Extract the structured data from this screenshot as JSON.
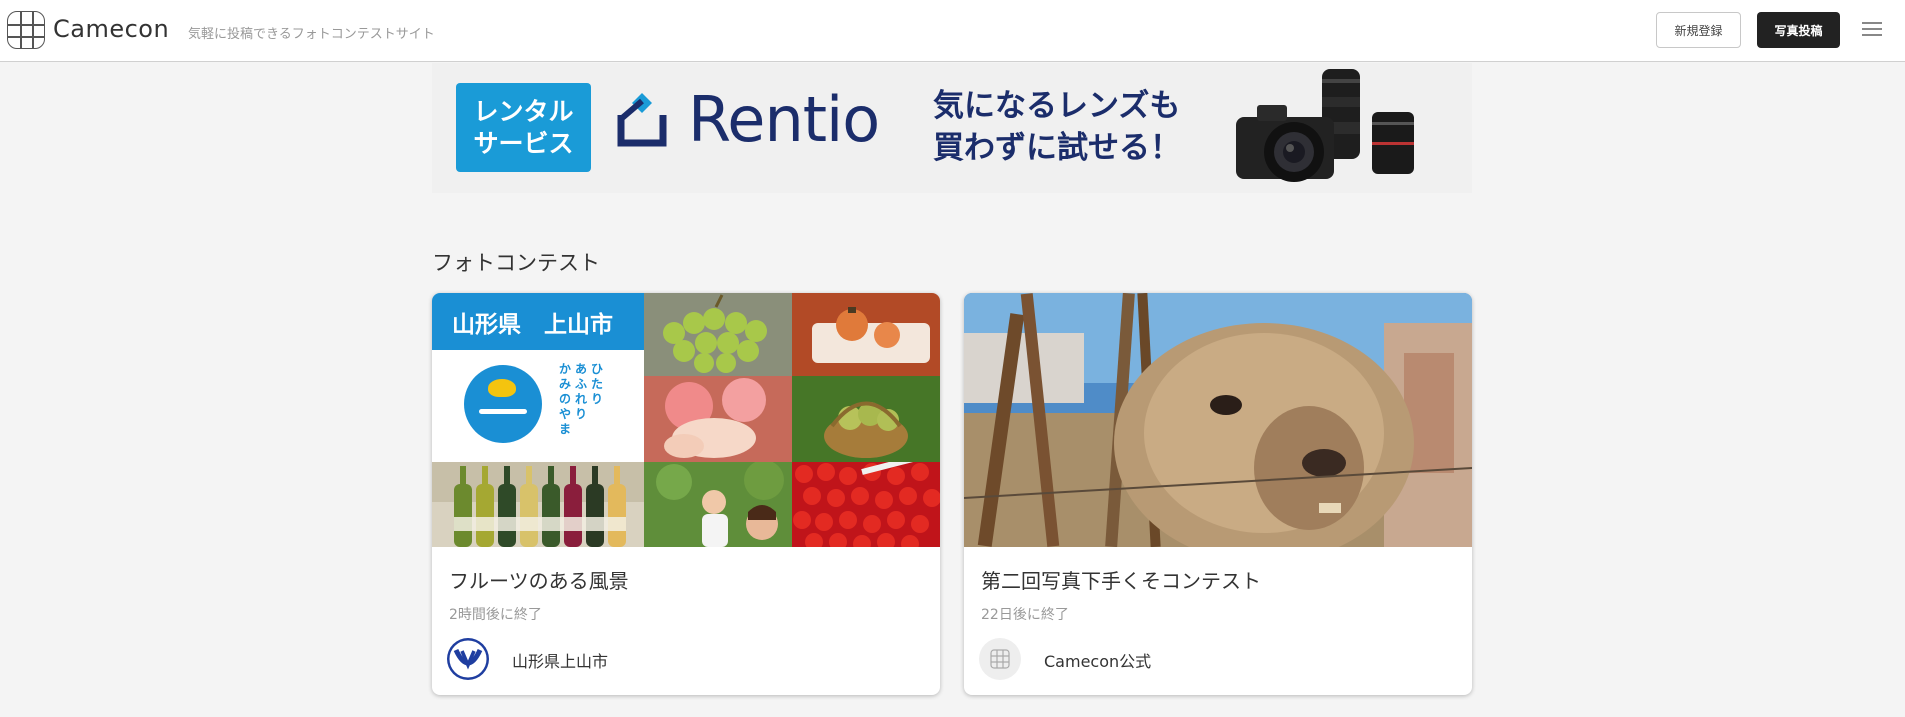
{
  "header": {
    "brand": "Camecon",
    "tagline": "気軽に投稿できるフォトコンテストサイト",
    "register_label": "新規登録",
    "post_label": "写真投稿"
  },
  "banner": {
    "box_line1": "レンタル",
    "box_line2": "サービス",
    "brand": "Rentio",
    "copy_line1": "気になるレンズも",
    "copy_line2": "買わずに試せる！",
    "colors": {
      "box": "#1a9bd7",
      "text": "#1b2d6b"
    }
  },
  "section": {
    "title": "フォトコンテスト"
  },
  "contests": [
    {
      "thumb_header": "山形県　上山市",
      "thumb_vertical": [
        "ひたり",
        "あふれり",
        "かみのやま"
      ],
      "title": "フルーツのある風景",
      "status": "2時間後に終了",
      "organizer": "山形県上山市"
    },
    {
      "title": "第二回写真下手くそコンテスト",
      "status": "22日後に終了",
      "organizer": "Camecon公式"
    }
  ]
}
